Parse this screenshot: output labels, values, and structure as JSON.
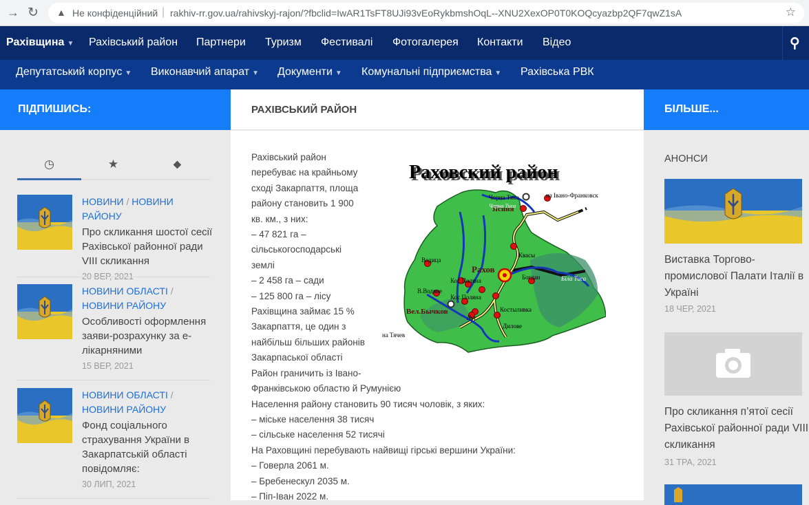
{
  "browser": {
    "insecure_label": "Не конфіденційний",
    "url": "rakhiv-rr.gov.ua/rahivskyj-rajon/?fbclid=IwAR1TsFT8UJi93vEoRykbmshOqL--XNU2XexOP0T0KOQcyazbp2QF7qwZ1sA"
  },
  "nav1": {
    "items": [
      "Рахівщина",
      "Рахівський район",
      "Партнери",
      "Туризм",
      "Фестивалі",
      "Фотогалерея",
      "Контакти",
      "Відео"
    ]
  },
  "nav2": {
    "items": [
      "Депутатський корпус",
      "Виконавчий апарат",
      "Документи",
      "Комунальні підприємства",
      "Рахівська РВК"
    ]
  },
  "left": {
    "header": "ПІДПИШИСЬ:",
    "posts": [
      {
        "cat1": "НОВИНИ",
        "cat2": "НОВИНИ РАЙОНУ",
        "title": "Про скликання шостої сесії Рахівської районної ради VIII скликання",
        "date": "20 ВЕР, 2021"
      },
      {
        "cat1": "НОВИНИ ОБЛАСТІ",
        "cat2": "НОВИНИ РАЙОНУ",
        "title": "Особливості оформлення заяви-розрахунку за е-лікарняними",
        "date": "15 ВЕР, 2021"
      },
      {
        "cat1": "НОВИНИ ОБЛАСТІ",
        "cat2": "НОВИНИ РАЙОНУ",
        "title": "Фонд соціального страхування України в Закарпатській області повідомляє:",
        "date": "30 ЛИП, 2021"
      }
    ]
  },
  "main": {
    "header": "РАХІВСЬКИЙ РАЙОН",
    "lines": [
      "     Рахівський район",
      "перебуває на крайньому",
      "сході Закарпаття, площа",
      "району становить 1 900",
      "кв. км., з них:",
      "– 47 821 га –",
      "сільськогосподарські",
      "землі",
      "– 2 458 га – сади",
      "– 125 800 га – лісу",
      "Рахівщина займає 15 %",
      "Закарпаття, це один з",
      "найбільш більших районів",
      "Закарпаської області",
      "Район граничить із Івано-",
      "Франківською областю й Румунією",
      "Населення району становить 90 тисяч чоловік, з яких:",
      "– міське населення 38 тисяч",
      "– сільське населення 52 тисячі",
      "На Раховщині перебувають найвищі гірські вершини України:",
      "– Говерла 2061 м.",
      "– Бребенескул 2035 м.",
      "– Піп-Іван 2022 м."
    ],
    "map": {
      "title": "Раховский район",
      "labels": [
        "Чорна Тиса",
        "на Івано-Франковск",
        "Ясиня",
        "Квасы",
        "Рахов",
        "Водица",
        "Кос.Поляна",
        "Кос.Поляна",
        "В.Водяне",
        "Вел.Бычков",
        "Луг",
        "Богдан",
        "Біла Тиса",
        "Костыливка",
        "Дилове",
        "на Тячев",
        "Чорна Тиса"
      ]
    }
  },
  "right": {
    "header": "БІЛЬШЕ...",
    "section": "АНОНСИ",
    "items": [
      {
        "title": "Виставка Торгово-промислової Палати Італії в Україні",
        "date": "18 ЧЕР, 2021"
      },
      {
        "title": "Про скликання п’ятої сесії Рахівської районної ради VIII скликання",
        "date": "31 ТРА, 2021"
      }
    ]
  },
  "colors": {
    "navy": "#0b2a6c",
    "nav2": "#0c3a8e",
    "accent": "#157dfa",
    "link": "#1a6fd8"
  }
}
